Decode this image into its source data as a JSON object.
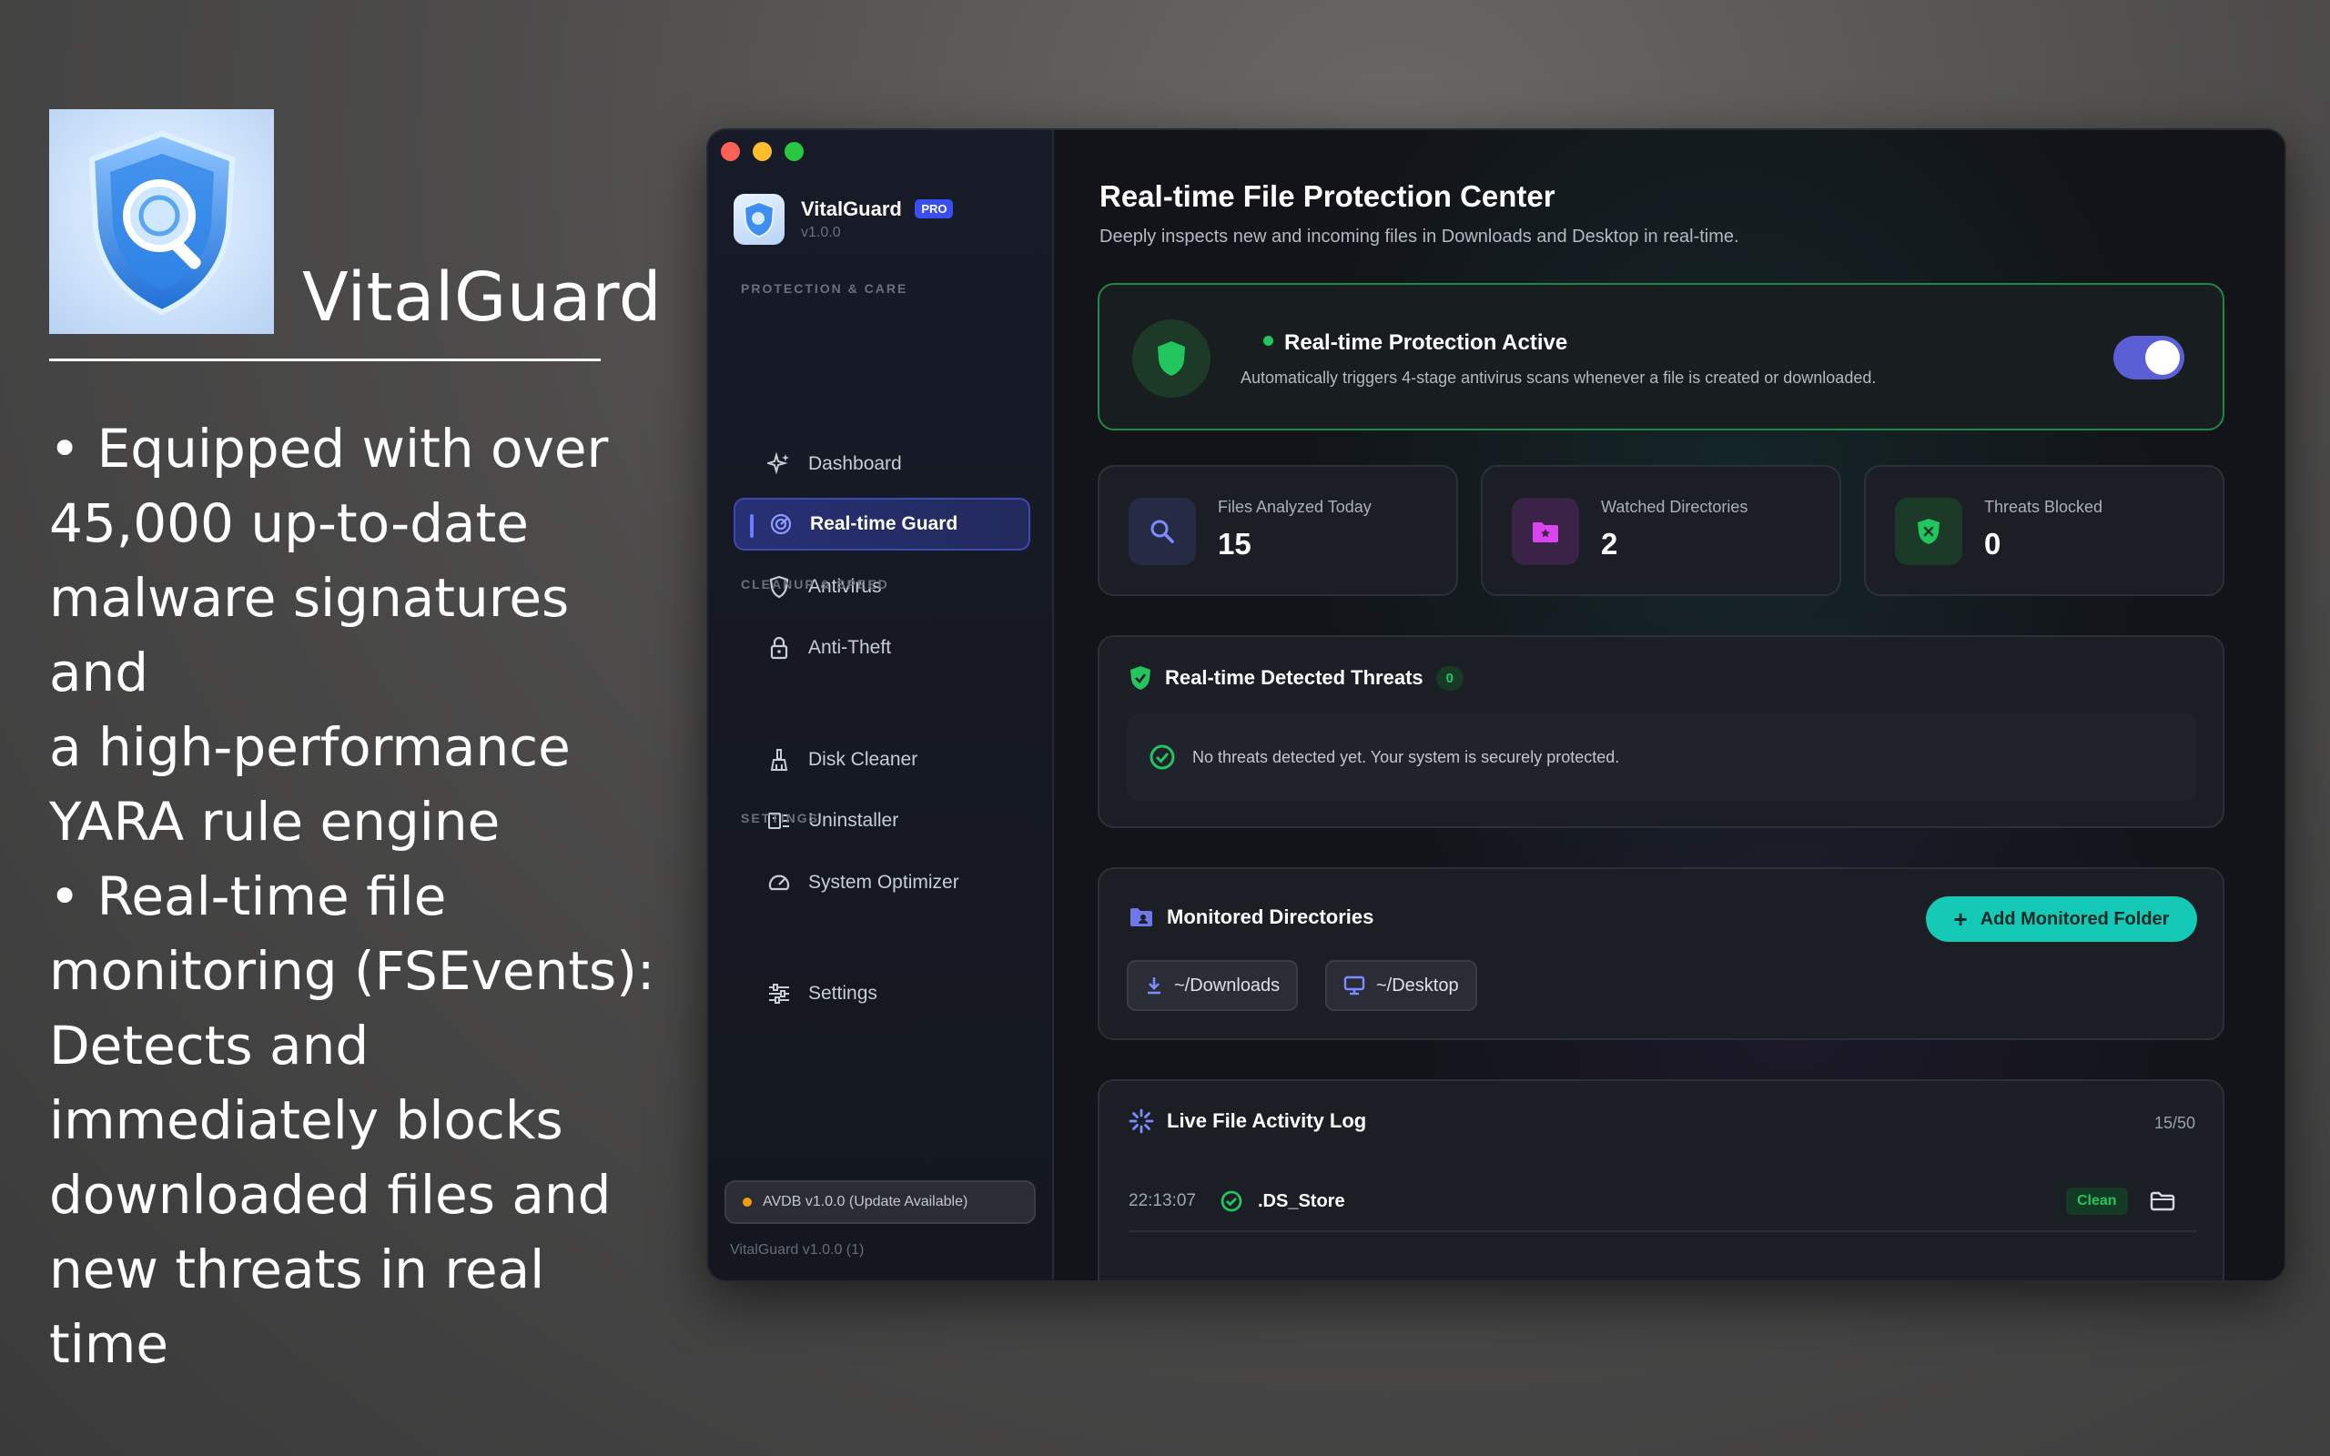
{
  "promo": {
    "app_name": "VitalGuard",
    "bullet1": "• Equipped with over\n45,000 up-to-date\nmalware signatures and\na high-performance\nYARA rule engine",
    "bullet2": "• Real-time file\nmonitoring (FSEvents):\nDetects and\nimmediately blocks\ndownloaded files and\nnew threats in real time"
  },
  "sidebar": {
    "brand_name": "VitalGuard",
    "badge": "PRO",
    "version": "v1.0.0",
    "sections": {
      "protection": "PROTECTION & CARE",
      "cleanup": "CLEANUP & SPEED",
      "settings": "SETTINGS"
    },
    "items": [
      {
        "label": "Dashboard",
        "icon": "sparkles-icon"
      },
      {
        "label": "Real-time Guard",
        "icon": "radar-icon",
        "active": true
      },
      {
        "label": "Antivirus",
        "icon": "shield-icon"
      },
      {
        "label": "Anti-Theft",
        "icon": "lock-icon"
      },
      {
        "label": "Disk Cleaner",
        "icon": "broom-icon"
      },
      {
        "label": "Uninstaller",
        "icon": "uninstall-icon"
      },
      {
        "label": "System Optimizer",
        "icon": "gauge-icon"
      },
      {
        "label": "Settings",
        "icon": "sliders-icon"
      }
    ],
    "avdb_status": "AVDB v1.0.0 (Update Available)",
    "footer": "VitalGuard v1.0.0 (1)"
  },
  "main": {
    "title": "Real-time File Protection Center",
    "subtitle": "Deeply inspects new and incoming files in Downloads and Desktop in real-time.",
    "protection": {
      "title": "Real-time Protection Active",
      "description": "Automatically triggers 4-stage antivirus scans whenever a file is created or downloaded.",
      "enabled": true
    },
    "stats": [
      {
        "label": "Files Analyzed Today",
        "value": "15",
        "icon": "search-icon"
      },
      {
        "label": "Watched Directories",
        "value": "2",
        "icon": "folder-star-icon"
      },
      {
        "label": "Threats Blocked",
        "value": "0",
        "icon": "shield-x-icon"
      }
    ],
    "threats": {
      "title": "Real-time Detected Threats",
      "count": "0",
      "empty_message": "No threats detected yet. Your system is securely protected."
    },
    "directories": {
      "title": "Monitored Directories",
      "add_button": "Add Monitored Folder",
      "items": [
        "~/Downloads",
        "~/Desktop"
      ]
    },
    "log": {
      "title": "Live File Activity Log",
      "count": "15/50",
      "rows": [
        {
          "time": "22:13:07",
          "file": ".DS_Store",
          "status": "Clean"
        }
      ]
    }
  },
  "colors": {
    "accent": "#5b5fd6",
    "success": "#22c55e",
    "teal_button": "#14c9b6",
    "warning": "#f59e0b"
  }
}
